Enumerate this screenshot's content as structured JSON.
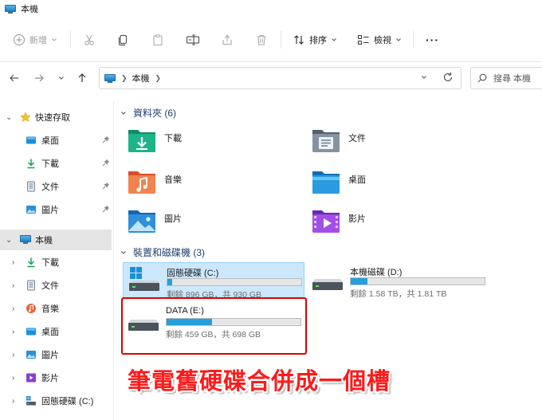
{
  "window": {
    "title": "本機"
  },
  "toolbar": {
    "new_label": "新增",
    "sort_label": "排序",
    "view_label": "檢視",
    "more_label": "···"
  },
  "address": {
    "crumb": "本機",
    "search_placeholder": "搜尋 本機"
  },
  "nav": {
    "quick_access": "快速存取",
    "quick_items": [
      {
        "label": "桌面",
        "icon": "desktop-icon"
      },
      {
        "label": "下載",
        "icon": "download-icon"
      },
      {
        "label": "文件",
        "icon": "document-icon"
      },
      {
        "label": "圖片",
        "icon": "pictures-icon"
      }
    ],
    "this_pc": "本機",
    "pc_items": [
      {
        "label": "下載",
        "icon": "download-icon"
      },
      {
        "label": "文件",
        "icon": "document-icon"
      },
      {
        "label": "音樂",
        "icon": "music-icon"
      },
      {
        "label": "桌面",
        "icon": "desktop-icon"
      },
      {
        "label": "圖片",
        "icon": "pictures-icon"
      },
      {
        "label": "影片",
        "icon": "videos-icon"
      },
      {
        "label": "固態硬碟 (C:)",
        "icon": "drive-icon"
      }
    ]
  },
  "folders_section": {
    "title": "資料夾 (6)"
  },
  "folders": [
    {
      "name": "下載",
      "icon": "downloads-folder-icon"
    },
    {
      "name": "文件",
      "icon": "documents-folder-icon"
    },
    {
      "name": "音樂",
      "icon": "music-folder-icon"
    },
    {
      "name": "桌面",
      "icon": "desktop-folder-icon"
    },
    {
      "name": "圖片",
      "icon": "pictures-folder-icon"
    },
    {
      "name": "影片",
      "icon": "videos-folder-icon"
    }
  ],
  "drives_section": {
    "title": "裝置和磁碟機 (3)"
  },
  "drives": [
    {
      "name": "固態硬碟 (C:)",
      "info": "剩餘 896 GB，共 930 GB",
      "used_fraction": 0.037
    },
    {
      "name": "本機磁碟 (D:)",
      "info": "剩餘 1.58 TB，共 1.81 TB",
      "used_fraction": 0.127
    },
    {
      "name": "DATA (E:)",
      "info": "剩餘 459 GB，共 698 GB",
      "used_fraction": 0.342
    }
  ],
  "annotation": {
    "text": "筆電舊硬碟合併成一個槽"
  },
  "colors": {
    "accent": "#26a0da",
    "annotation": "#ff1a1a",
    "selection": "#cce8ff"
  }
}
